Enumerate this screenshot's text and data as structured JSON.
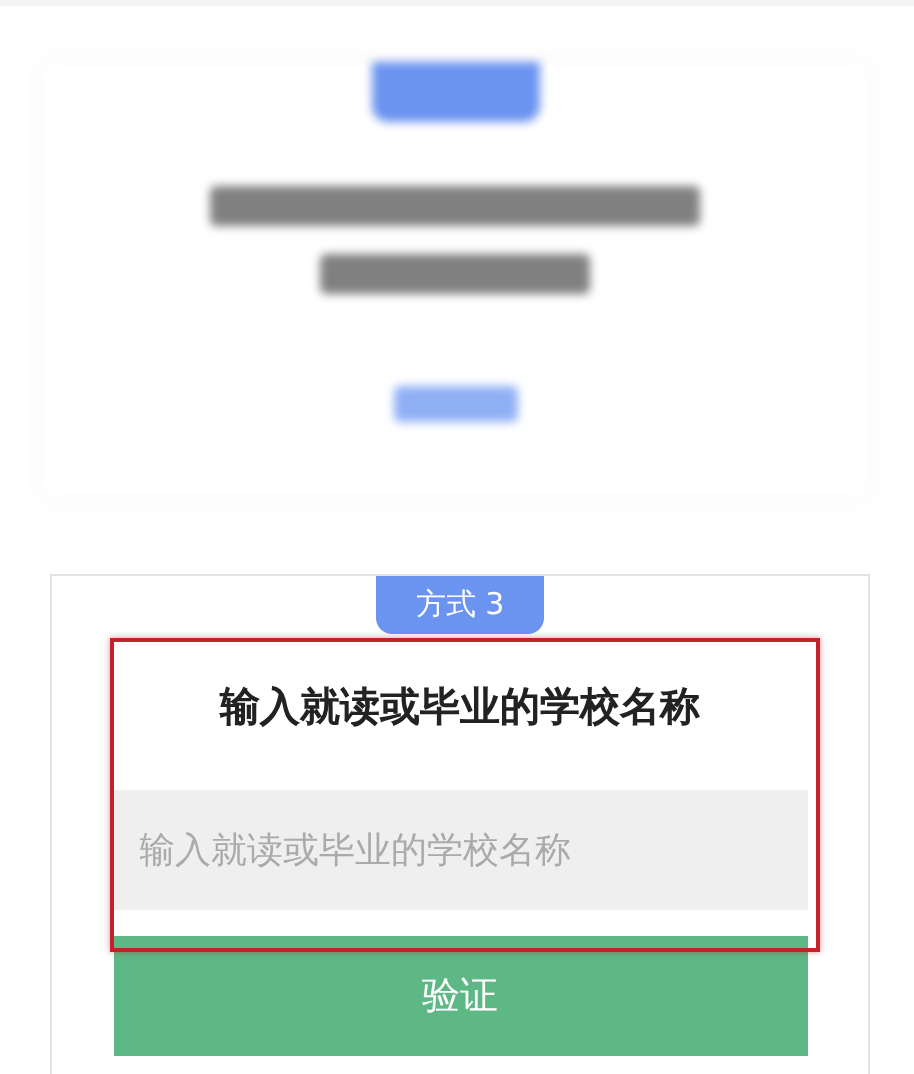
{
  "blurred_card": {
    "kind": "blurred"
  },
  "method_card": {
    "badge": "方式 3",
    "title": "输入就读或毕业的学校名称",
    "input": {
      "placeholder": "输入就读或毕业的学校名称"
    },
    "button": "验证"
  },
  "annotation": {
    "kind": "frame"
  }
}
